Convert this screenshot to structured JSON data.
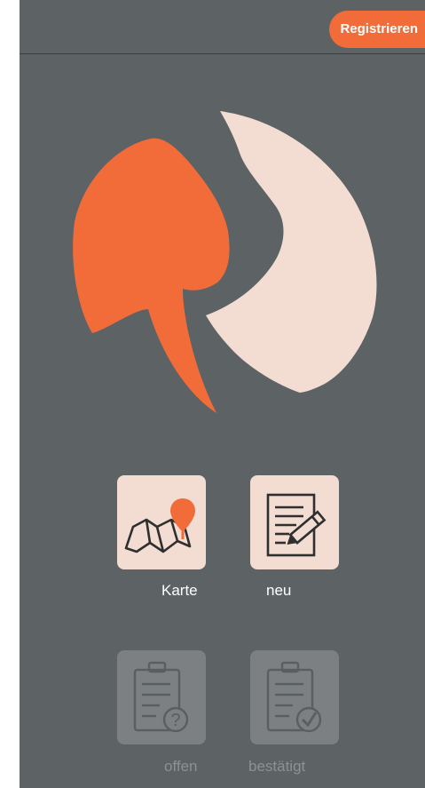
{
  "header": {
    "register_label": "Registrieren"
  },
  "logo": {
    "name": "app-logo"
  },
  "tiles": [
    {
      "label": "Karte",
      "icon": "map-pin-icon",
      "enabled": true
    },
    {
      "label": "neu",
      "icon": "edit-document-icon",
      "enabled": true
    },
    {
      "label": "offen",
      "icon": "clipboard-question-icon",
      "enabled": false
    },
    {
      "label": "bestätigt",
      "icon": "clipboard-check-icon",
      "enabled": false
    }
  ],
  "colors": {
    "background": "#5d6265",
    "accent": "#f26c3a",
    "logo_light": "#f3ddd3",
    "tile_active": "#f3ddd3",
    "tile_disabled": "#7c8083"
  }
}
